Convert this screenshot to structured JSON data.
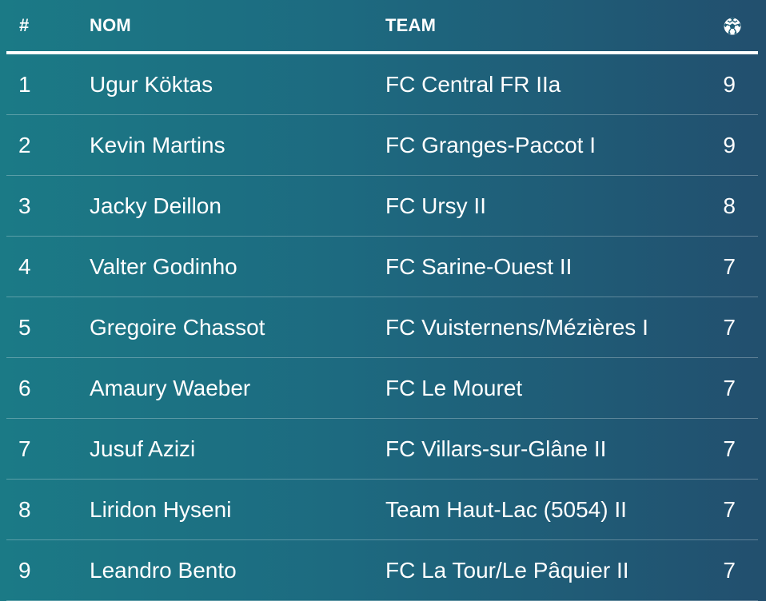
{
  "table": {
    "headers": {
      "rank": "#",
      "name": "NOM",
      "team": "TEAM",
      "goals_icon": "soccer-ball-icon"
    },
    "rows": [
      {
        "rank": "1",
        "name": "Ugur Köktas",
        "team": "FC Central FR IIa",
        "goals": "9"
      },
      {
        "rank": "2",
        "name": "Kevin Martins",
        "team": "FC Granges-Paccot I",
        "goals": "9"
      },
      {
        "rank": "3",
        "name": "Jacky Deillon",
        "team": "FC Ursy II",
        "goals": "8"
      },
      {
        "rank": "4",
        "name": "Valter Godinho",
        "team": "FC Sarine-Ouest II",
        "goals": "7"
      },
      {
        "rank": "5",
        "name": "Gregoire Chassot",
        "team": "FC Vuisternens/Mézières I",
        "goals": "7"
      },
      {
        "rank": "6",
        "name": "Amaury Waeber",
        "team": "FC Le Mouret",
        "goals": "7"
      },
      {
        "rank": "7",
        "name": "Jusuf Azizi",
        "team": "FC Villars-sur-Glâne II",
        "goals": "7"
      },
      {
        "rank": "8",
        "name": "Liridon Hyseni",
        "team": "Team Haut-Lac (5054) II",
        "goals": "7"
      },
      {
        "rank": "9",
        "name": "Leandro Bento",
        "team": "FC La Tour/Le Pâquier II",
        "goals": "7"
      }
    ]
  },
  "colors": {
    "background_left": "#1b7a86",
    "background_right": "#224f6e",
    "text": "#ffffff"
  }
}
